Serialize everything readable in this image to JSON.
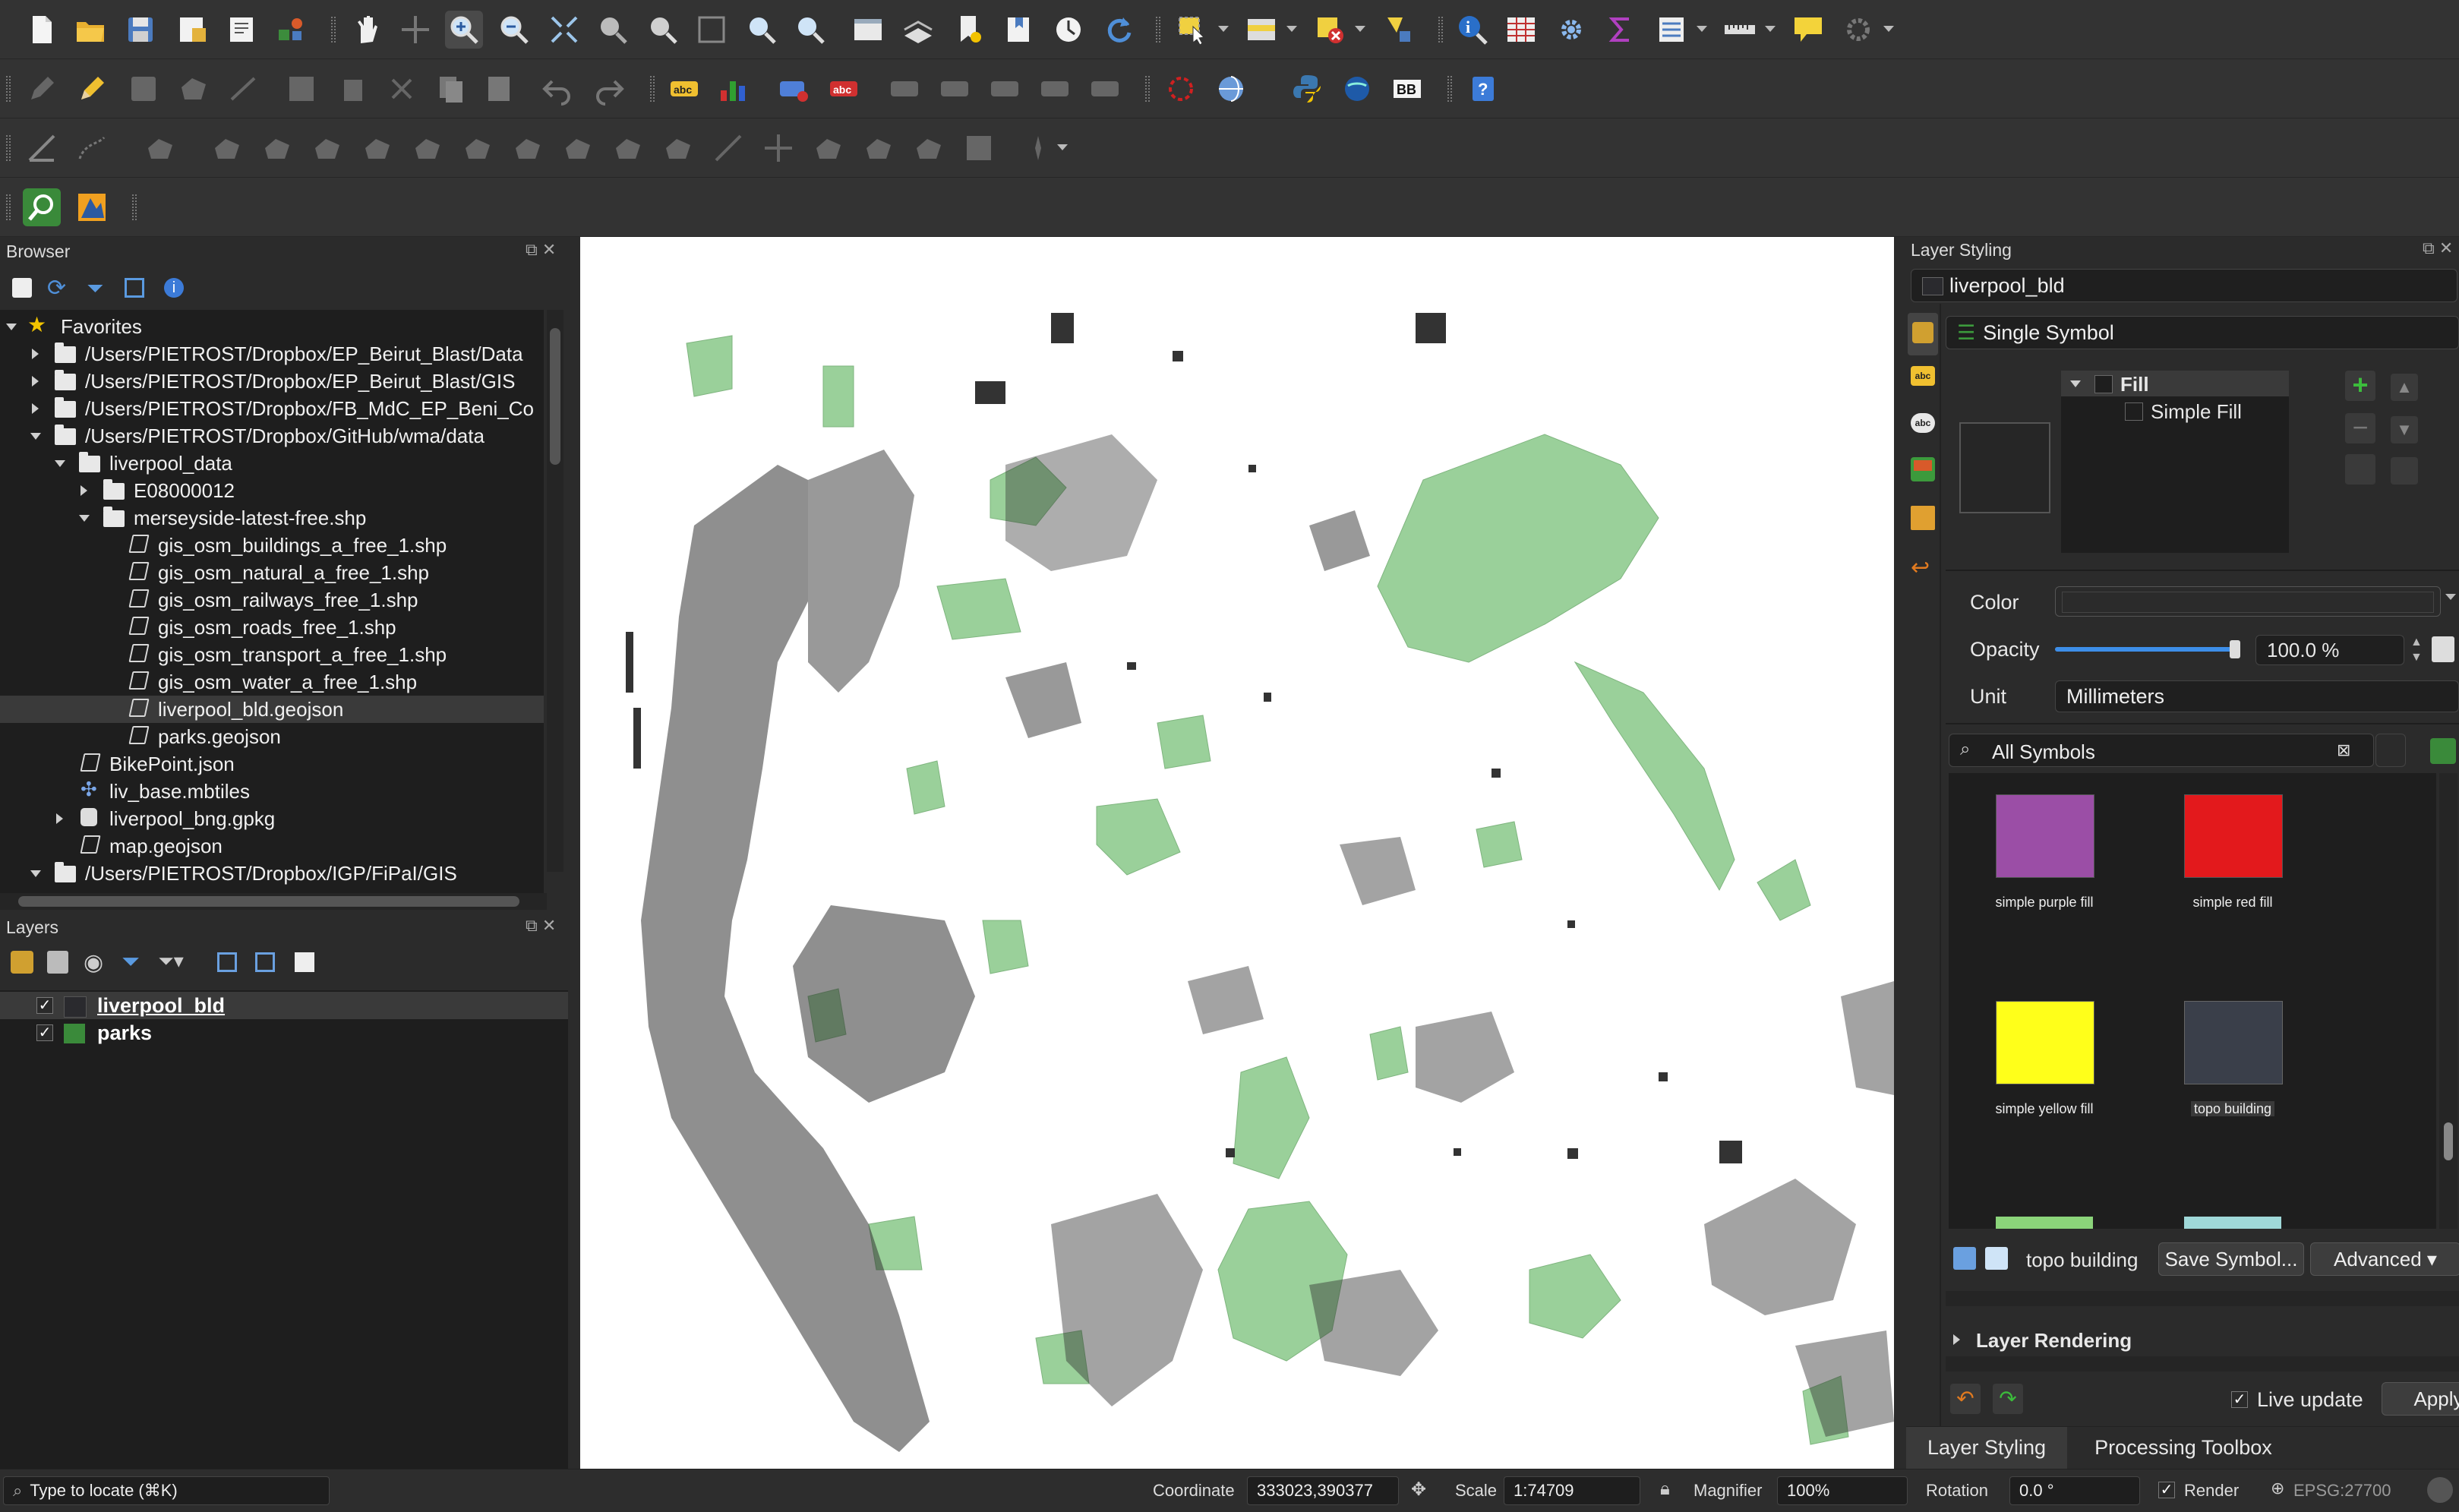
{
  "toolbar_icons": [
    "new-project-icon",
    "open-project-icon",
    "save-project-icon",
    "new-print-layout-icon",
    "layout-manager-icon",
    "style-manager-icon",
    "pan-map-icon",
    "pan-to-selection-icon",
    "zoom-in-icon",
    "zoom-out-icon",
    "zoom-full-icon",
    "zoom-to-selection-icon",
    "zoom-to-layer-icon",
    "zoom-native-icon",
    "zoom-last-icon",
    "zoom-next-icon",
    "new-map-view-icon",
    "new-3d-map-icon",
    "new-bookmark-icon",
    "show-bookmarks-icon",
    "temporal-controller-icon",
    "refresh-icon",
    "select-features-icon",
    "select-by-value-icon",
    "deselect-all-icon",
    "select-by-location-icon",
    "identify-features-icon",
    "attribute-table-icon",
    "toolbox-settings-icon",
    "statistics-sum-icon",
    "open-table-icon",
    "measure-line-icon",
    "map-tips-icon",
    "plugins-icon"
  ],
  "browser": {
    "title": "Browser",
    "items": [
      {
        "label": "Favorites"
      },
      {
        "label": "/Users/PIETROST/Dropbox/EP_Beirut_Blast/Data"
      },
      {
        "label": "/Users/PIETROST/Dropbox/EP_Beirut_Blast/GIS"
      },
      {
        "label": "/Users/PIETROST/Dropbox/FB_MdC_EP_Beni_Co"
      },
      {
        "label": "/Users/PIETROST/Dropbox/GitHub/wma/data"
      },
      {
        "label": "liverpool_data"
      },
      {
        "label": "E08000012"
      },
      {
        "label": "merseyside-latest-free.shp"
      },
      {
        "label": "gis_osm_buildings_a_free_1.shp"
      },
      {
        "label": "gis_osm_natural_a_free_1.shp"
      },
      {
        "label": "gis_osm_railways_free_1.shp"
      },
      {
        "label": "gis_osm_roads_free_1.shp"
      },
      {
        "label": "gis_osm_transport_a_free_1.shp"
      },
      {
        "label": "gis_osm_water_a_free_1.shp"
      },
      {
        "label": "liverpool_bld.geojson"
      },
      {
        "label": "parks.geojson"
      },
      {
        "label": "BikePoint.json"
      },
      {
        "label": "liv_base.mbtiles"
      },
      {
        "label": "liverpool_bng.gpkg"
      },
      {
        "label": "map.geojson"
      },
      {
        "label": "/Users/PIETROST/Dropbox/IGP/FiPaI/GIS"
      }
    ]
  },
  "layers": {
    "title": "Layers",
    "items": [
      {
        "label": "liverpool_bld",
        "checked": true,
        "color": "#2a2a2e"
      },
      {
        "label": "parks",
        "checked": true,
        "color": "#3a8a3a"
      }
    ]
  },
  "styling": {
    "title": "Layer Styling",
    "layer": "liverpool_bld",
    "renderer": "Single Symbol",
    "symbol_tree": [
      "Fill",
      "Simple Fill"
    ],
    "color_label": "Color",
    "opacity_label": "Opacity",
    "opacity_value": "100.0 %",
    "opacity_fraction": 1.0,
    "unit_label": "Unit",
    "unit_value": "Millimeters",
    "search_placeholder": "All Symbols",
    "swatches": [
      {
        "label": "simple purple fill",
        "color": "#9b4ea6"
      },
      {
        "label": "simple red fill",
        "color": "#e3191c"
      },
      {
        "label": "simple yellow fill",
        "color": "#ffff1a"
      },
      {
        "label": "topo building",
        "color": "#3a3f4a"
      }
    ],
    "symbol_name": "topo building",
    "save_symbol": "Save Symbol...",
    "advanced": "Advanced",
    "layer_rendering": "Layer Rendering",
    "live_update": "Live update",
    "apply": "Apply",
    "tabs": [
      "Layer Styling",
      "Processing Toolbox"
    ]
  },
  "status": {
    "locate_placeholder": "Type to locate (⌘K)",
    "coordinate_label": "Coordinate",
    "coordinate_value": "333023,390377",
    "scale_label": "Scale",
    "scale_value": "1:74709",
    "magnifier_label": "Magnifier",
    "magnifier_value": "100%",
    "rotation_label": "Rotation",
    "rotation_value": "0.0 °",
    "render_label": "Render",
    "crs": "EPSG:27700"
  }
}
